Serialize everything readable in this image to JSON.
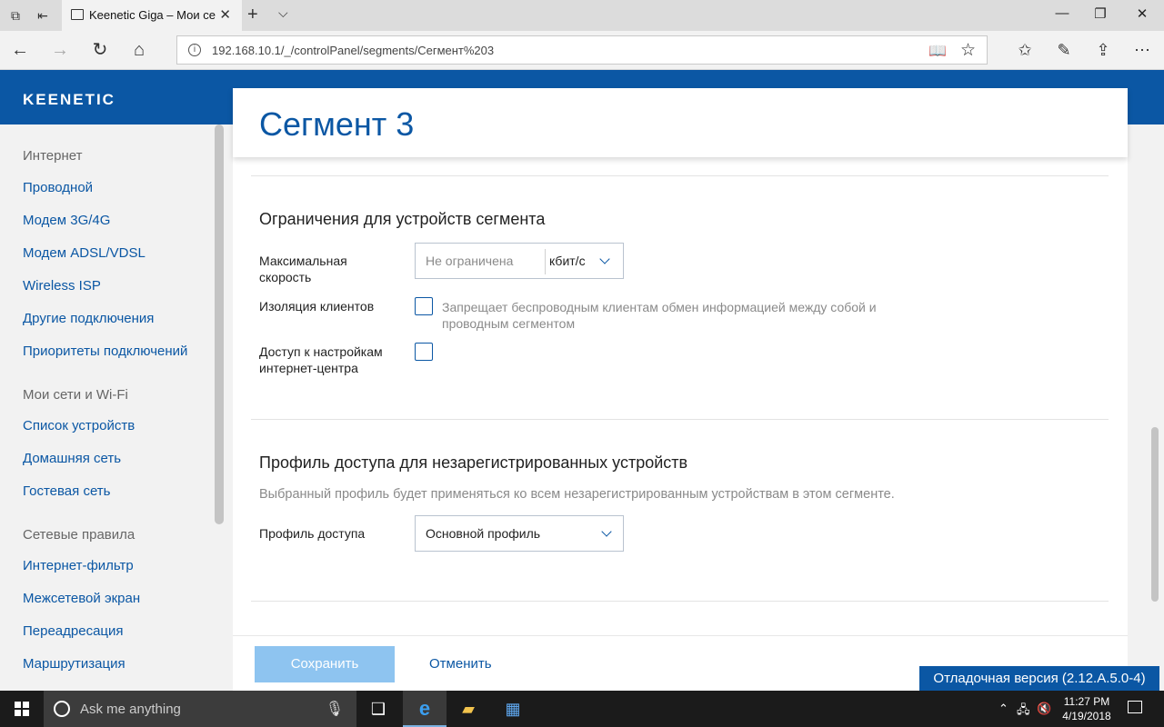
{
  "browser": {
    "tab_title": "Keenetic Giga – Мои се",
    "url": "192.168.10.1/_/controlPanel/segments/Сегмент%203"
  },
  "brand": {
    "logo_text": "KEENETIC",
    "accent": "#0b57a4"
  },
  "sidebar": {
    "groups": [
      {
        "label": "Интернет",
        "items": [
          "Проводной",
          "Модем 3G/4G",
          "Модем ADSL/VDSL",
          "Wireless ISP",
          "Другие подключения",
          "Приоритеты подключений"
        ]
      },
      {
        "label": "Мои сети и Wi-Fi",
        "items": [
          "Список устройств",
          "Домашняя сеть",
          "Гостевая сеть"
        ]
      },
      {
        "label": "Сетевые правила",
        "items": [
          "Интернет-фильтр",
          "Межсетевой экран",
          "Переадресация",
          "Маршрутизация"
        ]
      }
    ]
  },
  "page": {
    "title": "Сегмент 3",
    "limits": {
      "title": "Ограничения для устройств сегмента",
      "max_speed_label": "Максимальная скорость",
      "max_speed_placeholder": "Не ограничена",
      "max_speed_unit": "кбит/с",
      "isolation_label": "Изоляция клиентов",
      "isolation_checked": false,
      "isolation_hint": "Запрещает беспроводным клиентам обмен информацией между собой и проводным сегментом",
      "settings_access_label": "Доступ к настройкам интернет-центра",
      "settings_access_checked": false
    },
    "profile": {
      "title": "Профиль доступа для незарегистрированных устройств",
      "description": "Выбранный профиль будет применяться ко всем незарегистрированным устройствам в этом сегменте.",
      "label": "Профиль доступа",
      "value": "Основной профиль"
    },
    "actions": {
      "save": "Сохранить",
      "cancel": "Отменить"
    }
  },
  "debug_badge": "Отладочная версия (2.12.A.5.0-4)",
  "taskbar": {
    "search_placeholder": "Ask me anything",
    "time": "11:27 PM",
    "date": "4/19/2018"
  }
}
